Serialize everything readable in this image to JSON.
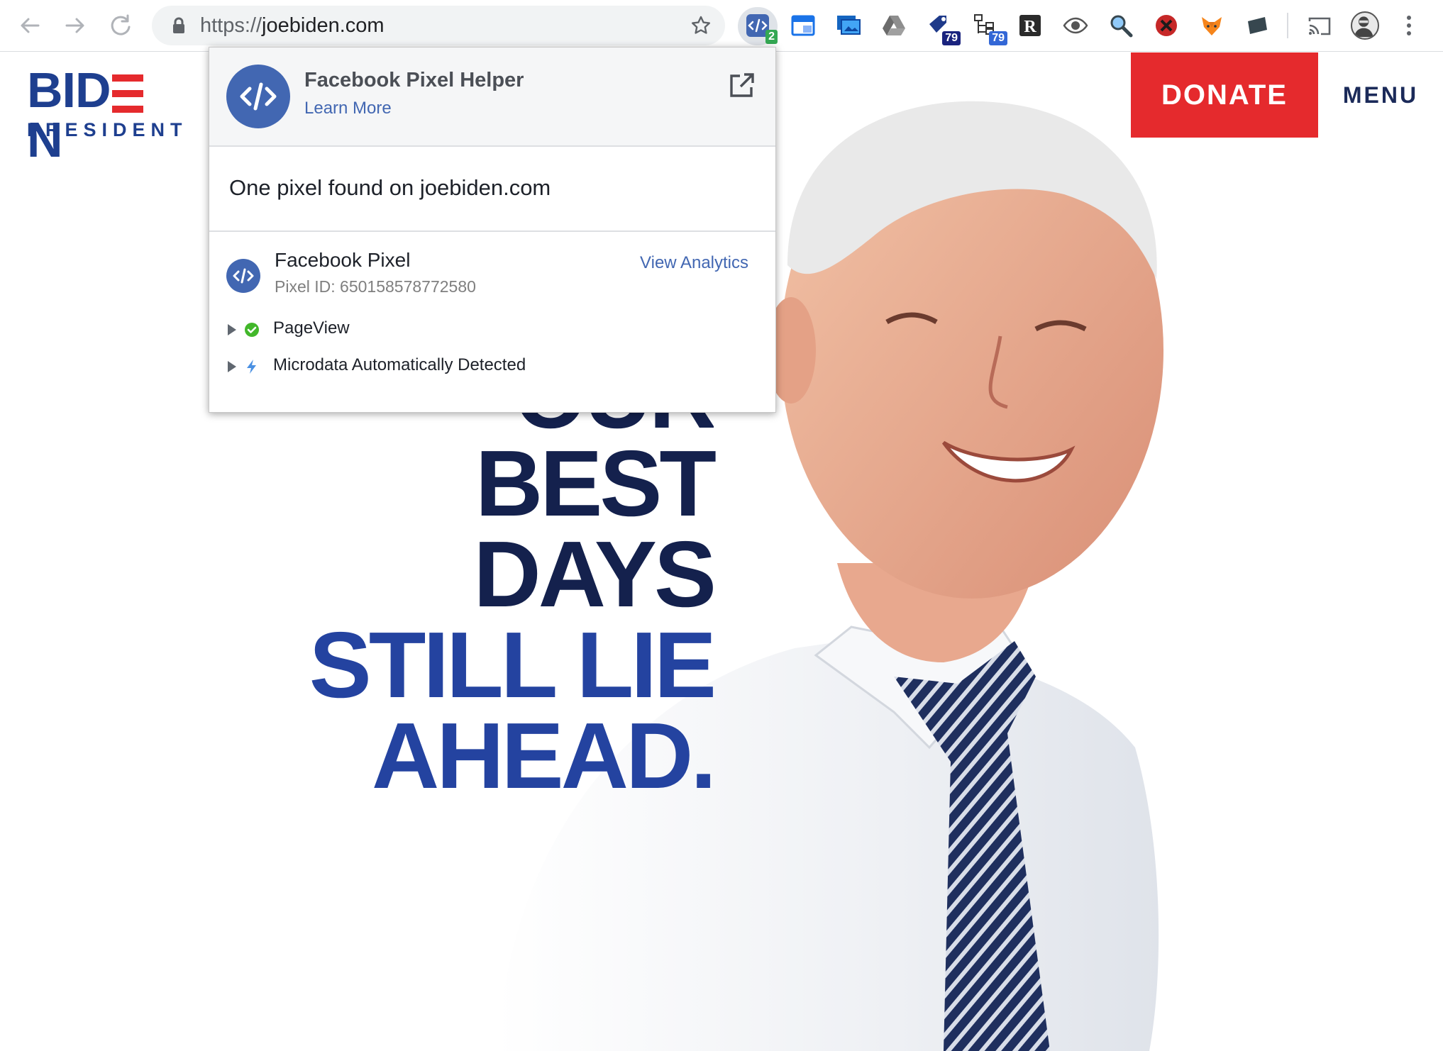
{
  "browser": {
    "url_scheme": "https://",
    "url_host": "joebiden.com",
    "extensions": [
      {
        "name": "facebook-pixel-helper-icon",
        "badge": "2",
        "badge_color": "#34a853"
      },
      {
        "name": "window-tab-icon"
      },
      {
        "name": "screenshot-icon"
      },
      {
        "name": "drive-icon"
      },
      {
        "name": "tag-icon",
        "badge": "79",
        "badge_color": "#1a237e"
      },
      {
        "name": "sitemap-icon",
        "badge": "79",
        "badge_color": "#3367d6"
      },
      {
        "name": "r-icon"
      },
      {
        "name": "eye-icon"
      },
      {
        "name": "magnifier-icon"
      },
      {
        "name": "blocker-icon"
      },
      {
        "name": "fox-icon"
      },
      {
        "name": "note-icon"
      }
    ]
  },
  "site": {
    "logo_main_left": "BID",
    "logo_main_right": "N",
    "logo_sub": "PRESIDENT",
    "donate_label": "DONATE",
    "menu_label": "MENU",
    "headline": {
      "line1": "OUR",
      "line2": "BEST",
      "line3": "DAYS",
      "line4": "STILL LIE",
      "line5": "AHEAD."
    },
    "colors": {
      "navy": "#14214d",
      "blue": "#2443a0",
      "red": "#e52a2d"
    }
  },
  "popup": {
    "title": "Facebook Pixel Helper",
    "learn_more": "Learn More",
    "summary": "One pixel found on joebiden.com",
    "pixel": {
      "name": "Facebook Pixel",
      "id_label": "Pixel ID: ",
      "id_value": "650158578772580",
      "analytics_link": "View Analytics",
      "events": [
        {
          "label": "PageView",
          "status": "success"
        },
        {
          "label": "Microdata Automatically Detected",
          "status": "auto"
        }
      ]
    }
  }
}
